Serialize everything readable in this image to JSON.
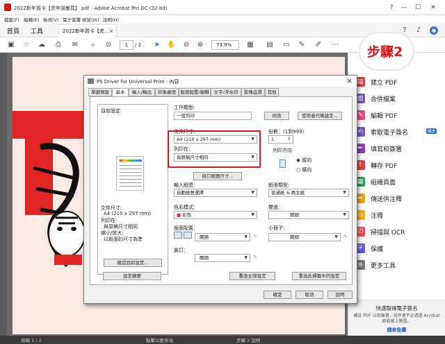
{
  "window": {
    "title": "2022新年賀卡【虎年誤嚴頁】.pdf - Adobe Acrobat Pro DC (32-bit)",
    "controls": {
      "minimize": "—",
      "maximize": "☐",
      "close": "✕"
    }
  },
  "menu": [
    "檔案(F)",
    "編輯(E)",
    "檢視(V)",
    "電子簽署",
    "視窗(W)",
    "說明(H)"
  ],
  "tabs": {
    "home": "首頁",
    "tools": "工具",
    "document": "2022新年賀卡【虎...",
    "doc_close": "×"
  },
  "toolbar": {
    "page_current": "1",
    "page_total": "/ 2",
    "zoom": "73.9%"
  },
  "step_label": "步驟2",
  "tools_pane": [
    {
      "label": "建立 PDF",
      "icon": "create-pdf-icon",
      "color": "#e03e3e"
    },
    {
      "label": "合併檔案",
      "icon": "combine-files-icon",
      "color": "#7e57c2"
    },
    {
      "label": "編輯 PDF",
      "icon": "edit-pdf-icon",
      "color": "#e64a8b"
    },
    {
      "label": "索取電子簽名",
      "icon": "request-signature-icon",
      "color": "#7e57c2",
      "badge": "樣本"
    },
    {
      "label": "填寫和簽署",
      "icon": "fill-sign-icon",
      "color": "#8e44ad"
    },
    {
      "label": "轉存 PDF",
      "icon": "export-pdf-icon",
      "color": "#d84343"
    },
    {
      "label": "組織頁面",
      "icon": "organize-pages-icon",
      "color": "#2e9e54"
    },
    {
      "label": "傳送供注釋",
      "icon": "send-comment-icon",
      "color": "#f0a020"
    },
    {
      "label": "注釋",
      "icon": "comment-icon",
      "color": "#f0b020"
    },
    {
      "label": "掃描與 OCR",
      "icon": "scan-ocr-icon",
      "color": "#e05050"
    },
    {
      "label": "保護",
      "icon": "protect-icon",
      "color": "#5b5bd6"
    },
    {
      "label": "更多工具",
      "icon": "more-tools-icon",
      "color": "#777777"
    }
  ],
  "promo": {
    "title": "快速取得電子簽名",
    "text": "傳送 PDF 以供簽署，收件者不必透過 Acrobat 即能線上簽署。",
    "link": "請來免費"
  },
  "status": {
    "left": "頁碼 1 / 2",
    "mid": "點擊以更多項",
    "right": "步驟 2 說明"
  },
  "dialog": {
    "title": "PS Driver for Universal Print - 內容",
    "tabs": [
      "單鍵預設",
      "基本",
      "輸入/輸出",
      "印後處理",
      "版面配置/編輯",
      "文字/浮水印",
      "影像品質",
      "其他"
    ],
    "active_tab": 1,
    "preview_label": "目前設定",
    "summary": {
      "paper_size_label": "文件尺寸:",
      "paper_size_value": "A4 (210 x 297 mm)",
      "print_on_label": "列印在:",
      "print_on_value": "與原稿尺寸相同",
      "zoom_label": "縮小/放大:",
      "zoom_value": "以紙張的尺寸為準"
    },
    "confirm_settings_btn": "確認目前設定...",
    "settings_summary_btn": "設定摘要",
    "job_type": {
      "label": "工作類型:",
      "value": "一般列印",
      "edit_btn": "修改",
      "user_settings_btn": "使用者代碼設定..."
    },
    "doc_size": {
      "label": "文件尺寸:",
      "value": "A4 (210 x 297 mm)"
    },
    "print_on": {
      "label": "列印在:",
      "value": "與原稿尺寸相同"
    },
    "copies": {
      "label": "份數：(1到999)",
      "value": "1"
    },
    "orientation": {
      "label": "列印方向",
      "portrait": "縱向",
      "landscape": "橫向"
    },
    "custom_size_btn": "自訂紙張尺寸...",
    "input_tray": {
      "label": "輸入紙匣：",
      "value": "自動紙匣選擇"
    },
    "paper_type": {
      "label": "紙張類型:",
      "value": "普通紙 & 再生紙"
    },
    "color_mode": {
      "label": "色彩模式：",
      "value": "彩色"
    },
    "duplex": {
      "label": "雙面：",
      "value": "關閉"
    },
    "layout": {
      "label": "版面配置：",
      "value": "關閉"
    },
    "booklet": {
      "label": "小冊子：",
      "value": "關閉"
    },
    "staple": {
      "label": "裝訂：",
      "value": "關閉"
    },
    "reset_all_btn": "重設全部設定",
    "reset_tab_btn": "重設此標籤中的設定",
    "ok_btn": "確定",
    "cancel_btn": "取消",
    "help_btn": "說明"
  },
  "colors": {
    "accent_red": "#d7191c",
    "link_blue": "#1a55c4"
  }
}
